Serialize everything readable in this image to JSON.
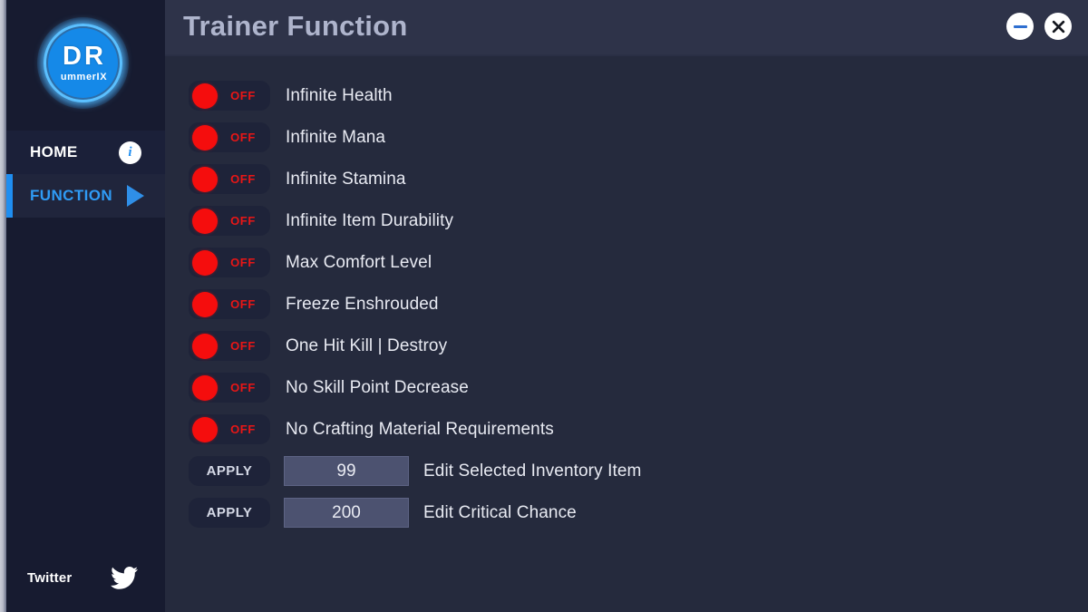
{
  "window": {
    "title": "Trainer Function",
    "minimize_label": "minimize",
    "close_label": "close"
  },
  "sidebar": {
    "logo": {
      "main_text": "DR",
      "sub_text": "ummerIX"
    },
    "nav": [
      {
        "label": "HOME",
        "icon": "info-icon",
        "active": false
      },
      {
        "label": "FUNCTION",
        "icon": "play-icon",
        "active": true
      }
    ],
    "social": {
      "label": "Twitter",
      "icon": "twitter-icon"
    }
  },
  "main": {
    "toggle_rows": [
      {
        "label": "Infinite Health",
        "state": "OFF"
      },
      {
        "label": "Infinite Mana",
        "state": "OFF"
      },
      {
        "label": "Infinite Stamina",
        "state": "OFF"
      },
      {
        "label": "Infinite Item Durability",
        "state": "OFF"
      },
      {
        "label": "Max Comfort Level",
        "state": "OFF"
      },
      {
        "label": "Freeze Enshrouded",
        "state": "OFF"
      },
      {
        "label": "One Hit Kill | Destroy",
        "state": "OFF"
      },
      {
        "label": "No Skill Point Decrease",
        "state": "OFF"
      },
      {
        "label": "No Crafting Material Requirements",
        "state": "OFF"
      }
    ],
    "value_rows": [
      {
        "button": "APPLY",
        "value": "99",
        "label": "Edit Selected Inventory Item"
      },
      {
        "button": "APPLY",
        "value": "200",
        "label": "Edit Critical Chance"
      }
    ]
  },
  "colors": {
    "sidebar_bg": "#171b30",
    "main_bg": "#252a3d",
    "titlebar_bg": "#2e3349",
    "accent_blue": "#1f8ef1",
    "toggle_off_red": "#f50d0d",
    "title_text": "#aeb4cc",
    "value_box_bg": "#4c5270"
  }
}
